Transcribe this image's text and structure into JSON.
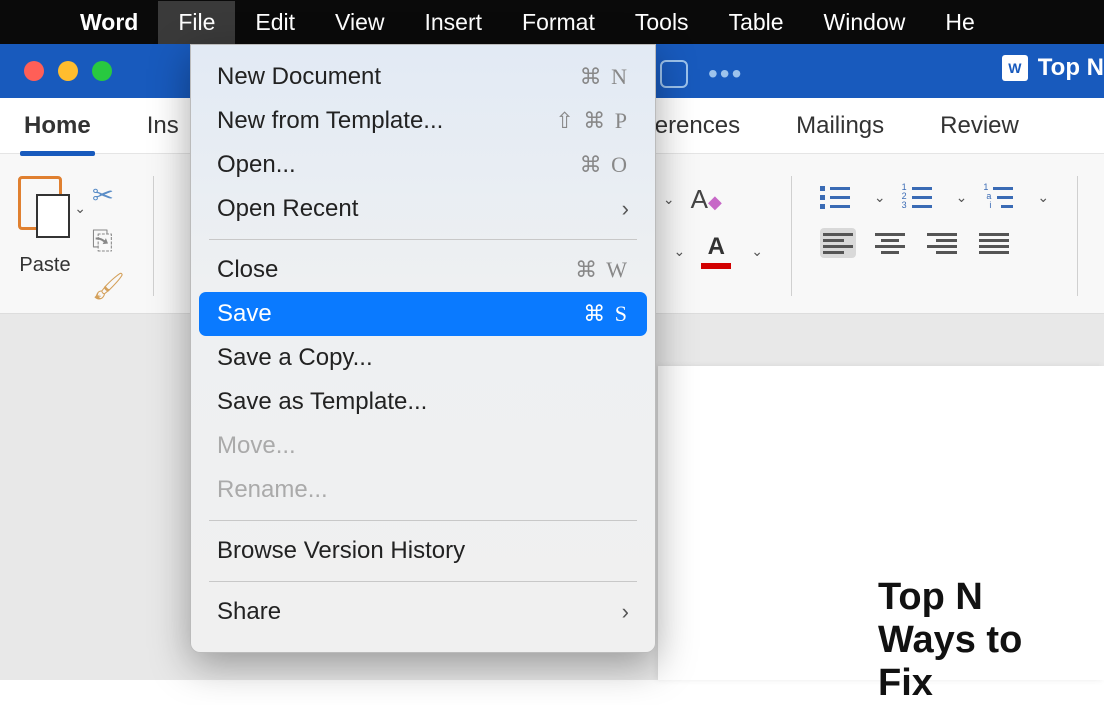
{
  "menubar": {
    "app": "Word",
    "items": [
      "File",
      "Edit",
      "View",
      "Insert",
      "Format",
      "Tools",
      "Table",
      "Window",
      "He"
    ],
    "active": "File"
  },
  "titlebar": {
    "doc_title": "Top N"
  },
  "ribbon": {
    "tabs": {
      "home": "Home",
      "insert_partial": "Ins",
      "references_partial": "eferences",
      "mailings": "Mailings",
      "review": "Review"
    },
    "paste_label": "Paste",
    "font_size_label": "Aa"
  },
  "file_menu": {
    "new_document": {
      "label": "New Document",
      "shortcut": "⌘ N"
    },
    "new_from_template": {
      "label": "New from Template...",
      "shortcut": "⇧ ⌘ P"
    },
    "open": {
      "label": "Open...",
      "shortcut": "⌘ O"
    },
    "open_recent": {
      "label": "Open Recent"
    },
    "close": {
      "label": "Close",
      "shortcut": "⌘ W"
    },
    "save": {
      "label": "Save",
      "shortcut": "⌘ S"
    },
    "save_a_copy": {
      "label": "Save a Copy..."
    },
    "save_as_template": {
      "label": "Save as Template..."
    },
    "move": {
      "label": "Move..."
    },
    "rename": {
      "label": "Rename..."
    },
    "browse_version_history": {
      "label": "Browse Version History"
    },
    "share": {
      "label": "Share"
    }
  },
  "document": {
    "heading": "Top N Ways to Fix"
  }
}
